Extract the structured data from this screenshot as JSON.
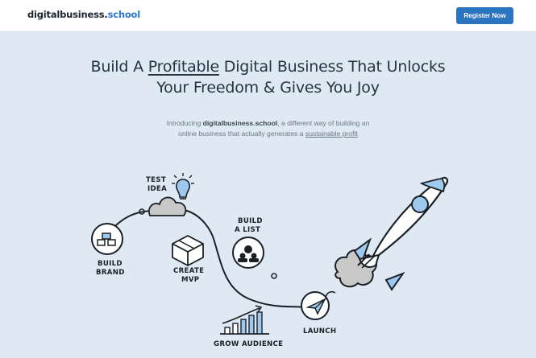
{
  "header": {
    "logo_main": "digitalbusiness.",
    "logo_accent": "school",
    "register_label": "Register Now"
  },
  "hero": {
    "title_part1": "Build A ",
    "title_emphasis": "Profitable",
    "title_part2": " Digital Business That Unlocks",
    "title_line2": "Your Freedom & Gives You Joy"
  },
  "intro": {
    "prefix": "Introducing ",
    "brand": "digitalbusiness.school",
    "middle": ", a different way of building an online business that actually generates a ",
    "link": "sustainable profit"
  },
  "journey": {
    "step1_line1": "BUILD",
    "step1_line2": "BRAND",
    "step2_line1": "TEST",
    "step2_line2": "IDEA",
    "step3_line1": "CREATE",
    "step3_line2": "MVP",
    "step4_line1": "BUILD",
    "step4_line2": "A LIST",
    "step5": "GROW AUDIENCE",
    "step6": "LAUNCH"
  },
  "colors": {
    "accent": "#2b74c0",
    "background": "#dfe9f4",
    "illustration_blue": "#9ec9ee",
    "cloud_gray": "#c9c9c9"
  }
}
